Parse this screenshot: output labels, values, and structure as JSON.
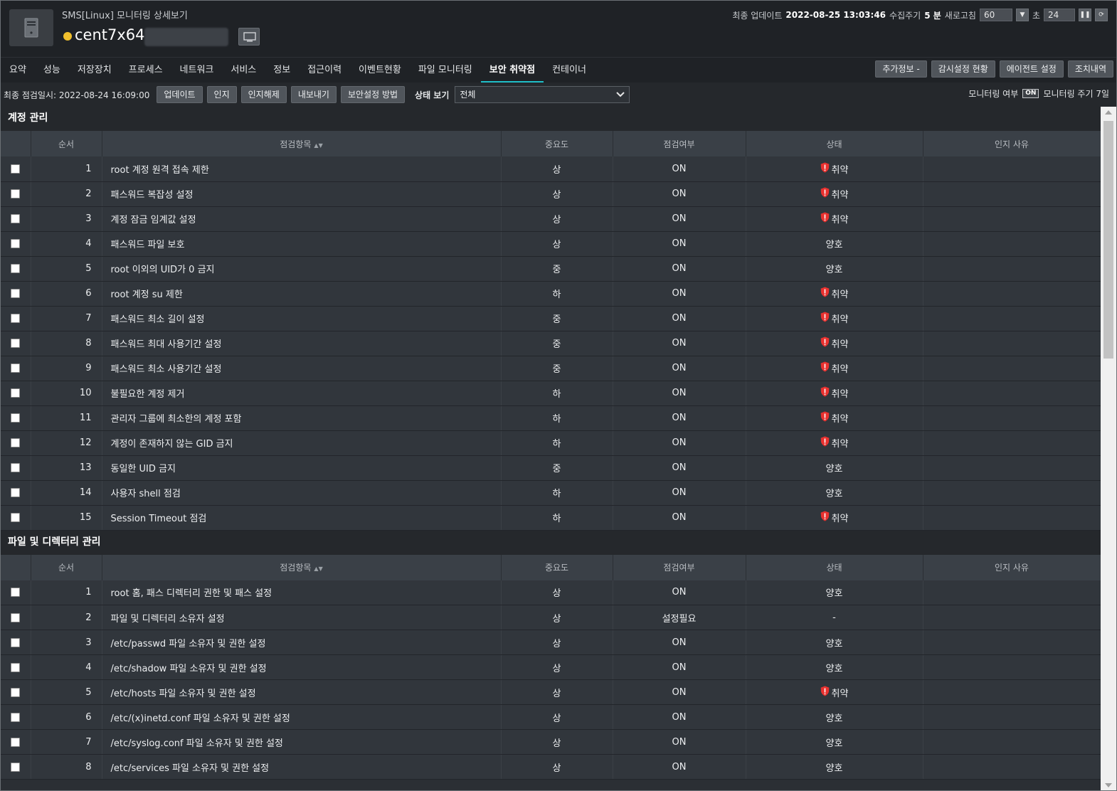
{
  "header": {
    "subtitle": "SMS[Linux] 모니터링 상세보기",
    "host": "cent7x64",
    "last_update_label": "최종 업데이트",
    "last_update_value": "2022-08-25 13:03:46",
    "collect_label": "수집주기",
    "collect_value": "5 분",
    "refresh_label": "새로고침",
    "refresh_value": "60",
    "sec_label": "초",
    "countdown": "24"
  },
  "tabs": [
    "요약",
    "성능",
    "저장장치",
    "프로세스",
    "네트워크",
    "서비스",
    "정보",
    "접근이력",
    "이벤트현황",
    "파일 모니터링",
    "보안 취약점",
    "컨테이너"
  ],
  "active_tab": "보안 취약점",
  "tab_buttons": [
    "추가정보 -",
    "감시설정 현황",
    "에이전트 설정",
    "조치내역"
  ],
  "toolbar": {
    "last_check": "최종 점검일시: 2022-08-24 16:09:00",
    "buttons": [
      "업데이트",
      "인지",
      "인지해제",
      "내보내기",
      "보안설정 방법"
    ],
    "status_view_label": "상태 보기",
    "status_view_value": "전체",
    "monitor_label": "모니터링 여부",
    "monitor_badge": "ON",
    "period_label": "모니터링 주기 7일"
  },
  "columns": [
    "순서",
    "점검항목",
    "중요도",
    "점검여부",
    "상태",
    "인지 사유"
  ],
  "colors": {
    "vulnerable": "#e8312f",
    "accent": "#1fbfc9"
  },
  "sections": [
    {
      "title": "계정 관리",
      "rows": [
        {
          "no": "1",
          "item": "root 계정 원격 접속 제한",
          "sev": "상",
          "chk": "ON",
          "status": "취약",
          "vuln": true
        },
        {
          "no": "2",
          "item": "패스워드 복잡성 설정",
          "sev": "상",
          "chk": "ON",
          "status": "취약",
          "vuln": true
        },
        {
          "no": "3",
          "item": "계정 잠금 임계값 설정",
          "sev": "상",
          "chk": "ON",
          "status": "취약",
          "vuln": true
        },
        {
          "no": "4",
          "item": "패스워드 파일 보호",
          "sev": "상",
          "chk": "ON",
          "status": "양호",
          "vuln": false
        },
        {
          "no": "5",
          "item": "root 이외의 UID가 0 금지",
          "sev": "중",
          "chk": "ON",
          "status": "양호",
          "vuln": false
        },
        {
          "no": "6",
          "item": "root 계정 su 제한",
          "sev": "하",
          "chk": "ON",
          "status": "취약",
          "vuln": true
        },
        {
          "no": "7",
          "item": "패스워드 최소 길이 설정",
          "sev": "중",
          "chk": "ON",
          "status": "취약",
          "vuln": true
        },
        {
          "no": "8",
          "item": "패스워드 최대 사용기간 설정",
          "sev": "중",
          "chk": "ON",
          "status": "취약",
          "vuln": true
        },
        {
          "no": "9",
          "item": "패스워드 최소 사용기간 설정",
          "sev": "중",
          "chk": "ON",
          "status": "취약",
          "vuln": true
        },
        {
          "no": "10",
          "item": "불필요한 계정 제거",
          "sev": "하",
          "chk": "ON",
          "status": "취약",
          "vuln": true
        },
        {
          "no": "11",
          "item": "관리자 그룹에 최소한의 계정 포함",
          "sev": "하",
          "chk": "ON",
          "status": "취약",
          "vuln": true
        },
        {
          "no": "12",
          "item": "계정이 존재하지 않는 GID 금지",
          "sev": "하",
          "chk": "ON",
          "status": "취약",
          "vuln": true
        },
        {
          "no": "13",
          "item": "동일한 UID 금지",
          "sev": "중",
          "chk": "ON",
          "status": "양호",
          "vuln": false
        },
        {
          "no": "14",
          "item": "사용자 shell 점검",
          "sev": "하",
          "chk": "ON",
          "status": "양호",
          "vuln": false
        },
        {
          "no": "15",
          "item": "Session Timeout 점검",
          "sev": "하",
          "chk": "ON",
          "status": "취약",
          "vuln": true
        }
      ]
    },
    {
      "title": "파일 및 디렉터리 관리",
      "rows": [
        {
          "no": "1",
          "item": "root 홈, 패스 디렉터리 권한 및 패스 설정",
          "sev": "상",
          "chk": "ON",
          "status": "양호",
          "vuln": false
        },
        {
          "no": "2",
          "item": "파일 및 디렉터리 소유자 설정",
          "sev": "상",
          "chk": "설정필요",
          "status": "-",
          "vuln": false
        },
        {
          "no": "3",
          "item": "/etc/passwd 파일 소유자 및 권한 설정",
          "sev": "상",
          "chk": "ON",
          "status": "양호",
          "vuln": false
        },
        {
          "no": "4",
          "item": "/etc/shadow 파일 소유자 및 권한 설정",
          "sev": "상",
          "chk": "ON",
          "status": "양호",
          "vuln": false
        },
        {
          "no": "5",
          "item": "/etc/hosts 파일 소유자 및 권한 설정",
          "sev": "상",
          "chk": "ON",
          "status": "취약",
          "vuln": true
        },
        {
          "no": "6",
          "item": "/etc/(x)inetd.conf 파일 소유자 및 권한 설정",
          "sev": "상",
          "chk": "ON",
          "status": "양호",
          "vuln": false
        },
        {
          "no": "7",
          "item": "/etc/syslog.conf 파일 소유자 및 권한 설정",
          "sev": "상",
          "chk": "ON",
          "status": "양호",
          "vuln": false
        },
        {
          "no": "8",
          "item": "/etc/services 파일 소유자 및 권한 설정",
          "sev": "상",
          "chk": "ON",
          "status": "양호",
          "vuln": false
        }
      ]
    }
  ]
}
